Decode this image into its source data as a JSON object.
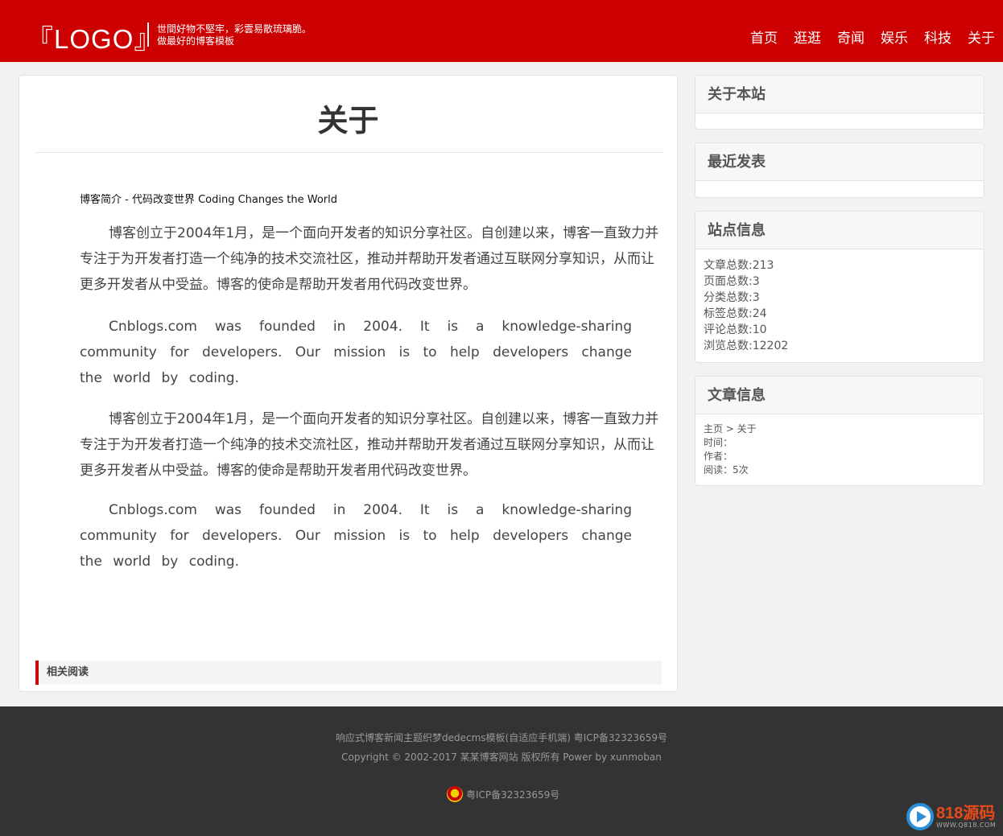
{
  "header": {
    "logo": "『LOGO』",
    "slogan_line1": "世間好物不堅牢，彩雲易散琉璃脆。",
    "slogan_line2": "做最好的博客模板",
    "nav": [
      "首页",
      "逛逛",
      "奇闻",
      "娱乐",
      "科技",
      "关于"
    ]
  },
  "article": {
    "title": "关于",
    "intro_heading": "博客简介 - 代码改变世界 Coding Changes the World",
    "paragraphs": [
      "博客创立于2004年1月，是一个面向开发者的知识分享社区。自创建以来，博客一直致力并专注于为开发者打造一个纯净的技术交流社区，推动并帮助开发者通过互联网分享知识，从而让更多开发者从中受益。博客的使命是帮助开发者用代码改变世界。",
      "Cnblogs.com was founded in 2004. It is a knowledge-sharing community for developers. Our mission is to help developers change the world by coding.",
      "博客创立于2004年1月，是一个面向开发者的知识分享社区。自创建以来，博客一直致力并专注于为开发者打造一个纯净的技术交流社区，推动并帮助开发者通过互联网分享知识，从而让更多开发者从中受益。博客的使命是帮助开发者用代码改变世界。",
      "Cnblogs.com was founded in 2004. It is a knowledge-sharing community for developers. Our mission is to help developers change the world by coding."
    ],
    "related_title": "相关阅读"
  },
  "sidebar": {
    "about_title": "关于本站",
    "recent_title": "最近发表",
    "site_info": {
      "title": "站点信息",
      "items": [
        "文章总数:213",
        "页面总数:3",
        "分类总数:3",
        "标签总数:24",
        "评论总数:10",
        "浏览总数:12202"
      ]
    },
    "article_info": {
      "title": "文章信息",
      "breadcrumb": "主页 > 关于",
      "time": "时间：",
      "author": "作者：",
      "views": "阅读：5次"
    }
  },
  "footer": {
    "line1": "响应式博客新闻主题织梦dedecms模板(自适应手机端) 粤ICP备32323659号",
    "line2": "Copyright © 2002-2017 某某博客网站 版权所有 Power by xunmoban",
    "beian": "粤ICP备32323659号"
  },
  "watermark": {
    "title": "818源码",
    "url": "WWW.Q818.COM"
  },
  "colors": {
    "brand": "#cc0000",
    "footer_bg": "#333333",
    "page_bg": "#f2f2f2"
  }
}
